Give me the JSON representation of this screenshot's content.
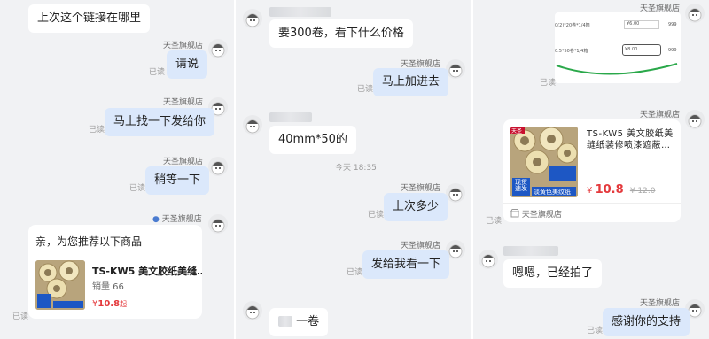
{
  "panel1": {
    "msg1": "上次这个链接在哪里",
    "shop_name": "天圣旗舰店",
    "msg2": "请说",
    "msg3": "马上找一下发给你",
    "msg4": "稍等一下",
    "read": "已读",
    "rec_card": {
      "title": "亲，为您推荐以下商品",
      "product_name": "TS-KW5 美文胶纸美缝…",
      "sales": "销量 66",
      "price_symbol": "¥",
      "price": "10.8",
      "price_suffix": "起"
    }
  },
  "panel2": {
    "msg1": "要300卷，看下什么价格",
    "shop_name": "天圣旗舰店",
    "msg2": "马上加进去",
    "msg3": "40mm*50的",
    "timestamp": "今天 18:35",
    "msg4": "上次多少",
    "msg5": "发给我看一下",
    "msg6": "一卷",
    "read": "已读"
  },
  "panel3": {
    "shop_name": "天圣旗舰店",
    "screenshot_row1_left": "0(2)*20卷*1/4箱",
    "screenshot_row1_val": "¥6.00",
    "screenshot_row1_right": "999",
    "screenshot_row2_left": "0.5*50卷*1/4箱",
    "screenshot_row2_val": "¥8.00",
    "screenshot_row2_right": "999",
    "product_card": {
      "name": "TS-KW5 美文胶纸美缝纸装修喷漆遮蔽…",
      "price_symbol": "¥",
      "price": "10.8",
      "old_price": "¥ 12.0",
      "shop": "天圣旗舰店",
      "thumb_badge": "天圣",
      "thumb_text1": "现货",
      "thumb_text2": "速发",
      "thumb_caption": "淡黄色美纹纸"
    },
    "msg_in": "嗯嗯，已经拍了",
    "msg_out": "感谢你的支持",
    "read": "已读"
  }
}
